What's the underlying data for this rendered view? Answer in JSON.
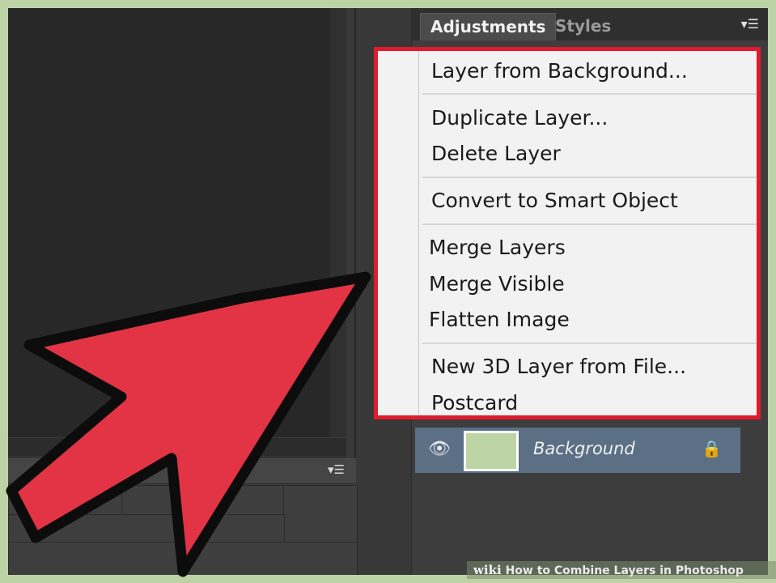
{
  "panel": {
    "tabs": [
      {
        "label": "Adjustments",
        "active": true
      },
      {
        "label": "Styles",
        "active": false
      }
    ],
    "menu_icon": "panel-menu-icon"
  },
  "context_menu": {
    "border_color": "#e21a2c",
    "groups": [
      [
        "Layer from Background..."
      ],
      [
        "Duplicate Layer...",
        "Delete Layer"
      ],
      [
        "Convert to Smart Object"
      ],
      [
        "Merge Layers",
        "Merge Visible",
        "Flatten Image"
      ],
      [
        "New 3D Layer from File...",
        "Postcard"
      ]
    ]
  },
  "layer": {
    "name": "Background",
    "thumbnail_color": "#bdd4a5",
    "icons": [
      "eye-icon",
      "lock-icon"
    ]
  },
  "annotation": {
    "arrow_color": "#e23444",
    "arrow_icon": "pointer-arrow-icon"
  },
  "footer": {
    "brand": "wiki",
    "title": "How to Combine Layers in Photoshop"
  }
}
